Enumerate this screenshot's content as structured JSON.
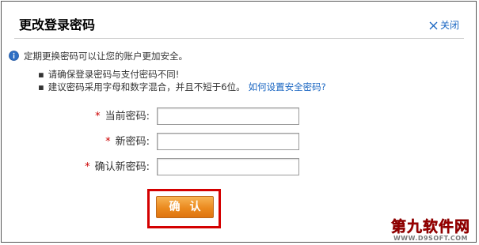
{
  "dialog": {
    "title": "更改登录密码",
    "close_label": "关闭"
  },
  "tips": {
    "main": "定期更换密码可以让您的账户更加安全。",
    "bullet_1": "请确保登录密码与支付密码不同!",
    "bullet_2": "建议密码采用字母和数字混合，并且不短于6位。",
    "help_link": "如何设置安全密码?"
  },
  "form": {
    "required_mark": "*",
    "current_password_label": "当前密码:",
    "new_password_label": "新密码:",
    "confirm_password_label": "确认新密码:",
    "current_password_value": "",
    "new_password_value": "",
    "confirm_password_value": ""
  },
  "confirm_button": {
    "label": "确认"
  },
  "watermark": {
    "main": "第九软件网",
    "sub": "WWW.D9SOFT.COM"
  },
  "colors": {
    "link": "#1a66c2",
    "required": "#cc0000",
    "button": "#eb8a1f",
    "highlight": "#d40000"
  },
  "icons": {
    "info": "info-icon",
    "close": "close-x-icon",
    "bullet": "bullet-icon"
  }
}
